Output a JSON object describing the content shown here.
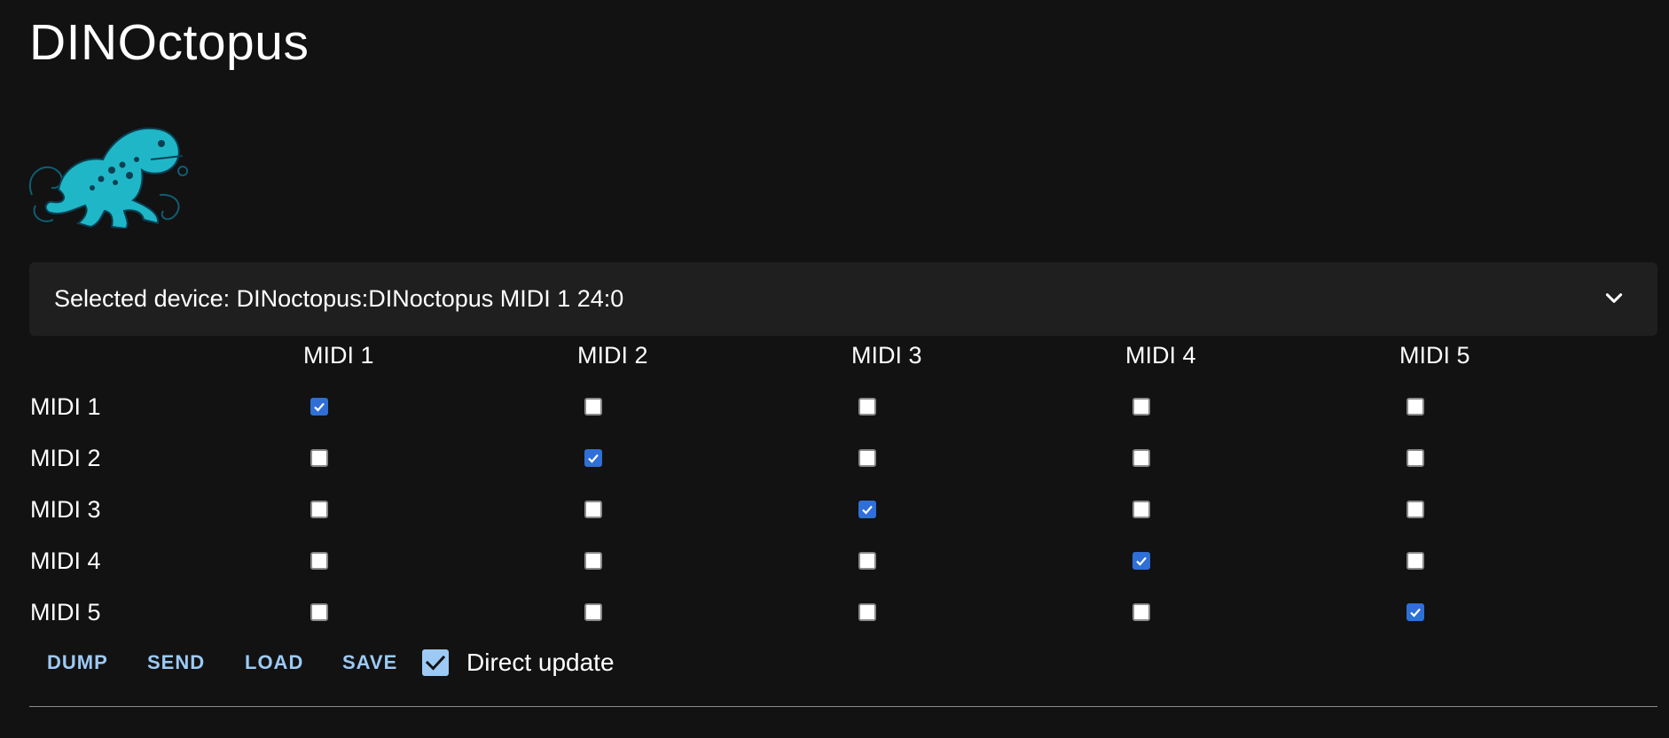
{
  "app": {
    "title": "DINOctopus"
  },
  "device_select": {
    "label": "Selected device: DINoctopus:DINoctopus MIDI 1 24:0"
  },
  "matrix": {
    "columns": [
      "MIDI 1",
      "MIDI 2",
      "MIDI 3",
      "MIDI 4",
      "MIDI 5"
    ],
    "rows": [
      {
        "label": "MIDI 1",
        "checked": [
          true,
          false,
          false,
          false,
          false
        ]
      },
      {
        "label": "MIDI 2",
        "checked": [
          false,
          true,
          false,
          false,
          false
        ]
      },
      {
        "label": "MIDI 3",
        "checked": [
          false,
          false,
          true,
          false,
          false
        ]
      },
      {
        "label": "MIDI 4",
        "checked": [
          false,
          false,
          false,
          true,
          false
        ]
      },
      {
        "label": "MIDI 5",
        "checked": [
          false,
          false,
          false,
          false,
          true
        ]
      }
    ]
  },
  "actions": {
    "dump": "DUMP",
    "send": "SEND",
    "load": "LOAD",
    "save": "SAVE"
  },
  "direct_update": {
    "label": "Direct update",
    "checked": true
  },
  "colors": {
    "background": "#121212",
    "panel": "#1f1f1f",
    "accent": "#9ccaf5",
    "checkbox_on": "#2f6fd6",
    "logo": "#1fb7c7"
  },
  "icons": {
    "logo": "octopus-logo-icon",
    "expand": "chevron-down-icon",
    "check": "check-icon"
  }
}
